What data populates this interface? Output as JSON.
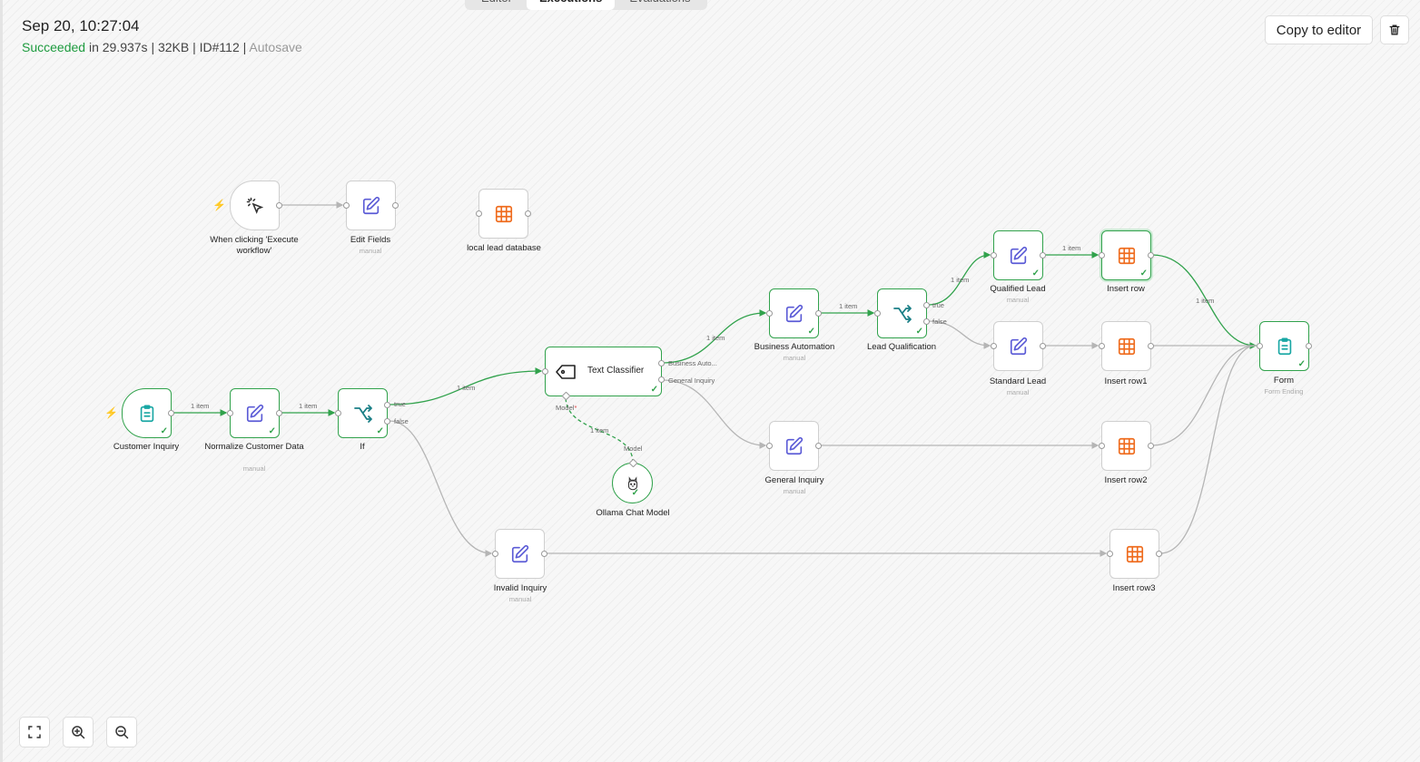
{
  "tabs": [
    "Editor",
    "Executions",
    "Evaluations"
  ],
  "execution": {
    "date": "Sep 20, 10:27:04",
    "status": "Succeeded",
    "duration": " in 29.937s | 32KB | ID#112 | ",
    "autosave": "Autosave"
  },
  "actions": {
    "copy_to_editor": "Copy to editor",
    "delete_icon": "trash-icon"
  },
  "zoom_controls": [
    "fit-view-icon",
    "zoom-in-icon",
    "zoom-out-icon"
  ],
  "colors": {
    "success": "#31a24c",
    "edit_icon": "#5b5bd6",
    "table_icon": "#ef6c1e",
    "form_icon": "#19a7a4",
    "trigger_bolt": "#f06a1e"
  },
  "nodes": {
    "manual_trigger": {
      "label": "When clicking 'Execute workflow'",
      "icon": "cursor-click-icon"
    },
    "edit_fields": {
      "label": "Edit Fields",
      "sub": "manual",
      "icon": "pencil-square-icon"
    },
    "local_db": {
      "label": "local lead database",
      "icon": "table-icon"
    },
    "customer_inquiry": {
      "label": "Customer Inquiry",
      "icon": "clipboard-icon"
    },
    "normalize": {
      "label": "Normalize Customer Data",
      "sub": "manual",
      "icon": "pencil-square-icon"
    },
    "if_node": {
      "label": "If",
      "icon": "branch-icon"
    },
    "text_classifier": {
      "label": "Text Classifier",
      "icon": "tag-icon"
    },
    "ollama": {
      "label": "Ollama Chat Model",
      "icon": "llama-icon"
    },
    "business_automation": {
      "label": "Business Automation",
      "sub": "manual",
      "icon": "pencil-square-icon"
    },
    "lead_qualification": {
      "label": "Lead Qualification",
      "icon": "branch-icon"
    },
    "qualified_lead": {
      "label": "Qualified Lead",
      "sub": "manual",
      "icon": "pencil-square-icon"
    },
    "standard_lead": {
      "label": "Standard Lead",
      "sub": "manual",
      "icon": "pencil-square-icon"
    },
    "insert_row": {
      "label": "Insert row",
      "icon": "table-icon"
    },
    "insert_row1": {
      "label": "Insert row1",
      "icon": "table-icon"
    },
    "general_inquiry": {
      "label": "General Inquiry",
      "sub": "manual",
      "icon": "pencil-square-icon"
    },
    "insert_row2": {
      "label": "Insert row2",
      "icon": "table-icon"
    },
    "invalid_inquiry": {
      "label": "Invalid Inquiry",
      "sub": "manual",
      "icon": "pencil-square-icon"
    },
    "insert_row3": {
      "label": "Insert row3",
      "icon": "table-icon"
    },
    "form": {
      "label": "Form",
      "sub": "Form Ending",
      "icon": "clipboard-icon"
    }
  },
  "edge_labels": {
    "item": "1 item",
    "if_true": "true",
    "if_false": "false",
    "lq_true": "true",
    "lq_false": "false",
    "tc_out1": "Business Auto...",
    "tc_out2": "General Inquiry",
    "model_in": "Model",
    "model_req": "*",
    "model_out": "Model"
  }
}
